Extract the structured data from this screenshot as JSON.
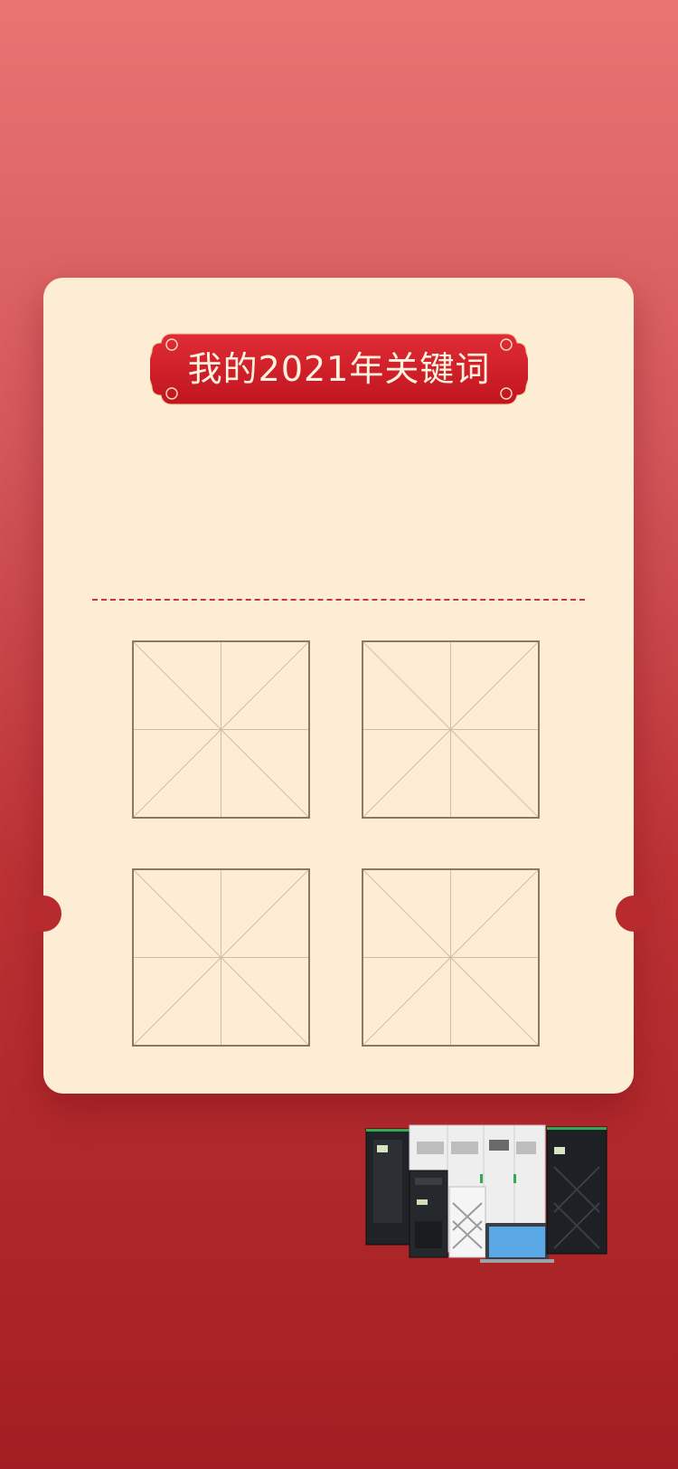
{
  "card": {
    "title": "我的2021年关键词"
  },
  "keyword_boxes": [
    {
      "id": 1
    },
    {
      "id": 2
    },
    {
      "id": 3
    },
    {
      "id": 4
    }
  ],
  "colors": {
    "banner_red": "#d0202d",
    "card_background": "#fdedd4",
    "divider": "#c7373a",
    "grid_border": "#8a7a62"
  },
  "icons": [
    "title-banner-ornament",
    "server-rack-product-image"
  ]
}
